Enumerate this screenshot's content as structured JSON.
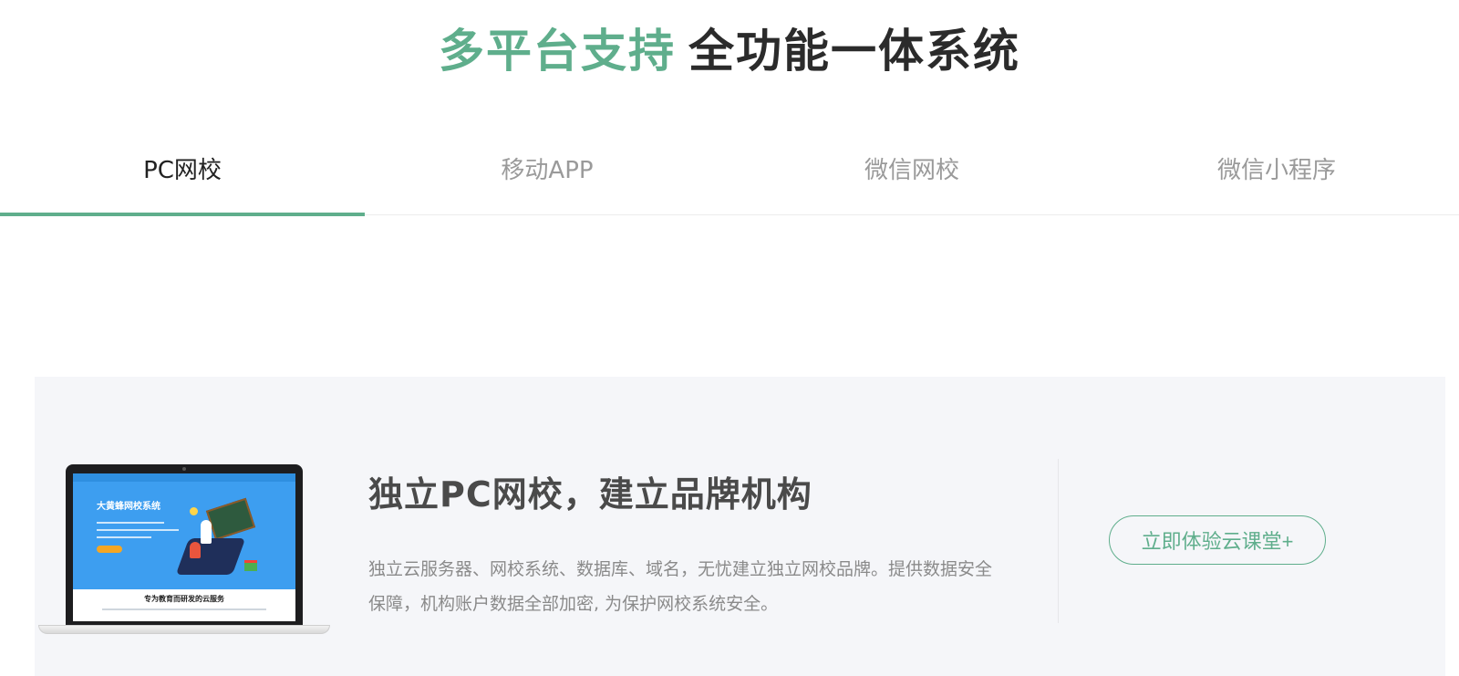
{
  "headline": {
    "accent": "多平台支持",
    "rest": "全功能一体系统"
  },
  "tabs": [
    {
      "label": "PC网校",
      "active": true
    },
    {
      "label": "移动APP",
      "active": false
    },
    {
      "label": "微信网校",
      "active": false
    },
    {
      "label": "微信小程序",
      "active": false
    }
  ],
  "panel": {
    "title": "独立PC网校，建立品牌机构",
    "description": "独立云服务器、网校系统、数据库、域名，无忧建立独立网校品牌。提供数据安全保障，机构账户数据全部加密, 为保护网校系统安全。",
    "cta_label": "立即体验云课堂+",
    "screen": {
      "hero_title": "大黄蜂网校系统",
      "caption": "专为教育而研发的云服务"
    }
  },
  "colors": {
    "accent": "#5fae8c",
    "panel_bg": "#f5f6f9",
    "hero_blue": "#3d9ef0"
  }
}
